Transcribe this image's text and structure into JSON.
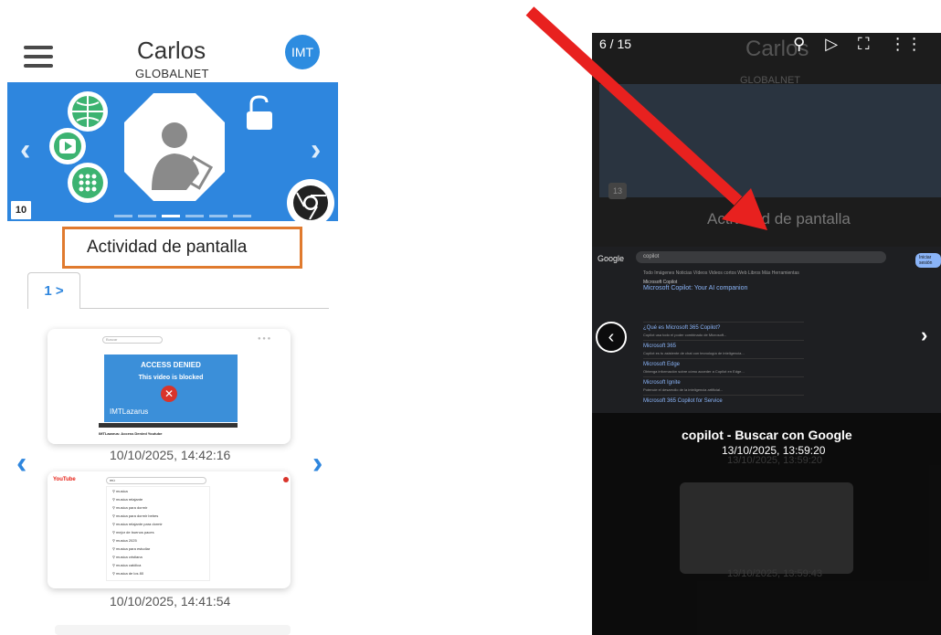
{
  "left": {
    "header": {
      "name": "Carlos",
      "company": "GLOBALNET",
      "avatar": "IMT"
    },
    "banner": {
      "day_badge": "10"
    },
    "section_title": "Actividad de pantalla",
    "tab_label": "1 >",
    "thumb1": {
      "search_placeholder": "Buscar",
      "banner_title": "ACCESS DENIED",
      "banner_sub": "This video is blocked",
      "brand": "IMTLazarus",
      "caption": "IMTLazarus: Access Denied Youtube",
      "date": "10/10/2025, 14:42:16"
    },
    "thumb2": {
      "logo": "YouTube",
      "query": "mú",
      "suggestions": [
        "musica",
        "musica relajante",
        "musica para dormir",
        "musica para dormir bebes",
        "musica relajante para dormir",
        "mejor de buenos paces",
        "musica 2025",
        "musica para estudiar",
        "musica cristiana",
        "musica católica",
        "musica de los 80"
      ],
      "date": "10/10/2025, 14:41:54"
    }
  },
  "right": {
    "counter": "6 / 15",
    "toolbar_icons": [
      "search-icon",
      "play-icon",
      "fullscreen-icon",
      "grid-icon",
      "close-icon"
    ],
    "bg_name": "Carlos",
    "bg_company": "GLOBALNET",
    "bg_badge": "13",
    "bg_title": "Actividad de pantalla",
    "screenshot": {
      "google": "Google",
      "query": "copilot",
      "filters": "Todo   Imágenes   Noticias   Vídeos   Videos cortos   Web   Libros   Más   Herramientas",
      "copilot_site": "Microsoft Copilot",
      "copilot_head": "Microsoft Copilot: Your AI companion",
      "results": [
        {
          "title": "¿Qué es Microsoft 365 Copilot?",
          "sub": "Copilot usa todo el poder combinado de Microsoft..."
        },
        {
          "title": "Microsoft 365",
          "sub": "Copilot es tu asistente de chat con tecnología de inteligencia..."
        },
        {
          "title": "Microsoft Edge",
          "sub": "Obtenga información sobre cómo acceder a Copilot en Edge..."
        },
        {
          "title": "Microsoft Ignite",
          "sub": "Potencie el desarrollo de la inteligencia artificial..."
        },
        {
          "title": "Microsoft 365 Copilot for Service",
          "sub": ""
        }
      ],
      "sign_in": "Iniciar sesión"
    },
    "caption_title": "copilot - Buscar con Google",
    "caption_date": "13/10/2025, 13:59:20",
    "bg_date1": "13/10/2025, 13:59:20",
    "bg_date2": "13/10/2025, 13:59:43"
  },
  "colors": {
    "accent": "#2e86de",
    "highlight": "#e07a2e",
    "arrow": "#e8211f"
  }
}
